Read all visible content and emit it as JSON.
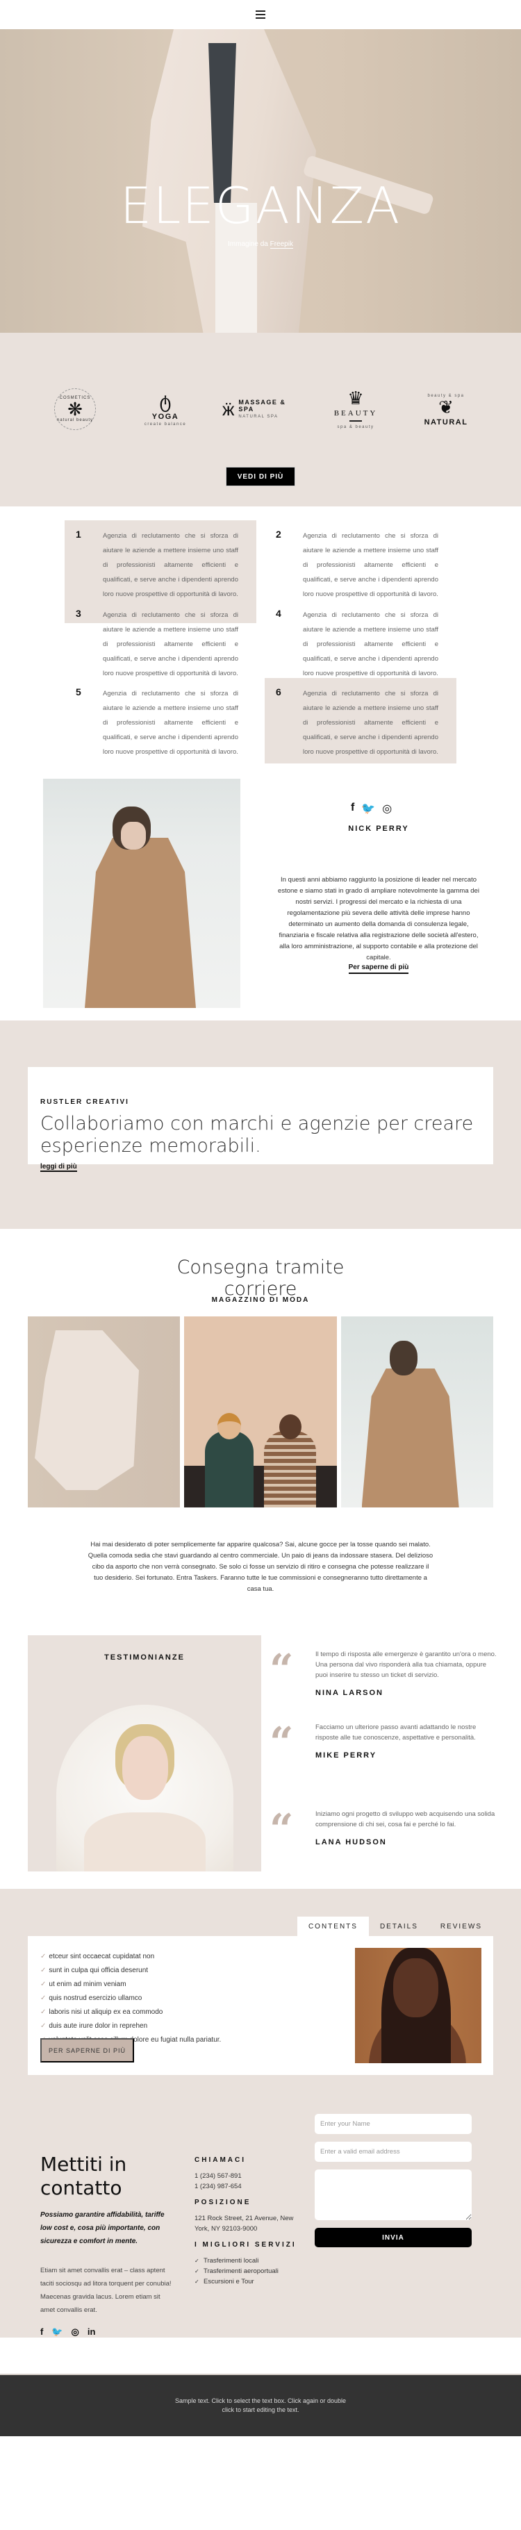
{
  "header": {
    "menu_icon": "hamburger-icon"
  },
  "hero": {
    "title": "ELEGANZA",
    "credit_prefix": "Immagine da ",
    "credit_link": "Freepik"
  },
  "logos": {
    "items": [
      {
        "name": "COSMETICS",
        "sub": "natural beauty",
        "icon": "flower-icon"
      },
      {
        "name": "YOGA",
        "sub": "create balance",
        "icon": "yoga-figure-icon"
      },
      {
        "name": "MASSAGE & SPA",
        "sub": "NATURAL SPA",
        "icon": "butterfly-figure-icon"
      },
      {
        "name": "BEAUTY",
        "sub": "spa & beauty",
        "icon": "lotus-icon"
      },
      {
        "name": "NATURAL",
        "sub": "beauty & spa",
        "icon": "leaves-figure-icon"
      }
    ],
    "cta": "VEDI DI PIÙ"
  },
  "numbered": {
    "items": [
      {
        "num": "1",
        "text": "Agenzia di reclutamento che si sforza di aiutare le aziende a mettere insieme uno staff di professionisti altamente efficienti e qualificati, e serve anche i dipendenti aprendo loro nuove prospettive di opportunità di lavoro.",
        "highlighted": true
      },
      {
        "num": "2",
        "text": "Agenzia di reclutamento che si sforza di aiutare le aziende a mettere insieme uno staff di professionisti altamente efficienti e qualificati, e serve anche i dipendenti aprendo loro nuove prospettive di opportunità di lavoro.",
        "highlighted": false
      },
      {
        "num": "3",
        "text": "Agenzia di reclutamento che si sforza di aiutare le aziende a mettere insieme uno staff di professionisti altamente efficienti e qualificati, e serve anche i dipendenti aprendo loro nuove prospettive di opportunità di lavoro.",
        "highlighted": false
      },
      {
        "num": "4",
        "text": "Agenzia di reclutamento che si sforza di aiutare le aziende a mettere insieme uno staff di professionisti altamente efficienti e qualificati, e serve anche i dipendenti aprendo loro nuove prospettive di opportunità di lavoro.",
        "highlighted": false
      },
      {
        "num": "5",
        "text": "Agenzia di reclutamento che si sforza di aiutare le aziende a mettere insieme uno staff di professionisti altamente efficienti e qualificati, e serve anche i dipendenti aprendo loro nuove prospettive di opportunità di lavoro.",
        "highlighted": false
      },
      {
        "num": "6",
        "text": "Agenzia di reclutamento che si sforza di aiutare le aziende a mettere insieme uno staff di professionisti altamente efficienti e qualificati, e serve anche i dipendenti aprendo loro nuove prospettive di opportunità di lavoro.",
        "highlighted": true
      }
    ]
  },
  "profile": {
    "social": [
      "f",
      "🐦",
      "◎"
    ],
    "name": "NICK PERRY",
    "bio": "In questi anni abbiamo raggiunto la posizione di leader nel mercato estone e siamo stati in grado di ampliare notevolmente la gamma dei nostri servizi. I progressi del mercato e la richiesta di una regolamentazione più severa delle attività delle imprese hanno determinato un aumento della domanda di consulenza legale, finanziaria e fiscale relativa alla registrazione delle società all'estero, alla loro amministrazione, al supporto contabile e alla protezione del capitale.",
    "link": "Per saperne di più"
  },
  "creative": {
    "kicker": "RUSTLER CREATIVI",
    "headline": "Collaboriamo con marchi e agenzie per creare esperienze memorabili.",
    "link": "leggi di più"
  },
  "delivery": {
    "title": "Consegna tramite corriere",
    "subtitle": "MAGAZZINO DI MODA",
    "paragraph": "Hai mai desiderato di poter semplicemente far apparire qualcosa? Sai, alcune gocce per la tosse quando sei malato. Quella comoda sedia che stavi guardando al centro commerciale. Un paio di jeans da indossare stasera. Del delizioso cibo da asporto che non verrà consegnato. Se solo ci fosse un servizio di ritiro e consegna che potesse realizzare il tuo desiderio. Sei fortunato. Entra Taskers. Faranno tutte le tue commissioni e consegneranno tutto direttamente a casa tua."
  },
  "testimonials": {
    "heading": "TESTIMONIANZE",
    "items": [
      {
        "text": "Il tempo di risposta alle emergenze è garantito un'ora o meno. Una persona dal vivo risponderà alla tua chiamata, oppure puoi inserire tu stesso un ticket di servizio.",
        "name": "NINA LARSON"
      },
      {
        "text": "Facciamo un ulteriore passo avanti adattando le nostre risposte alle tue conoscenze, aspettative e personalità.",
        "name": "MIKE PERRY"
      },
      {
        "text": "Iniziamo ogni progetto di sviluppo web acquisendo una solida comprensione di chi sei, cosa fai e perché lo fai.",
        "name": "LANA HUDSON"
      }
    ]
  },
  "tabs": {
    "labels": [
      "CONTENTS",
      "DETAILS",
      "REVIEWS"
    ],
    "active": "CONTENTS",
    "checklist": [
      "etceur sint occaecat cupidatat non",
      "sunt in culpa qui officia deserunt",
      "ut enim ad minim veniam",
      "quis nostrud esercizio ullamco",
      "laboris nisi ut aliquip ex ea commodo",
      "duis aute irure dolor in reprehen",
      "voluptate velit esse cillum dolore eu fugiat nulla pariatur."
    ],
    "button": "PER SAPERNE DI PIÙ"
  },
  "contact": {
    "title": "Mettiti in contatto",
    "lead": "Possiamo garantire affidabilità, tariffe low cost e, cosa più importante, con sicurezza e comfort in mente.",
    "body": "Etiam sit amet convallis erat – class aptent taciti sociosqu ad litora torquent per conubia! Maecenas gravida lacus. Lorem etiam sit amet convallis erat.",
    "call_heading": "CHIAMACI",
    "phones": [
      "1 (234) 567-891",
      "1 (234) 987-654"
    ],
    "location_heading": "POSIZIONE",
    "address": "121 Rock Street, 21 Avenue, New York, NY 92103-9000",
    "services_heading": "I MIGLIORI SERVIZI",
    "services": [
      "Trasferimenti locali",
      "Trasferimenti aeroportuali",
      "Escursioni e Tour"
    ],
    "social": [
      "f",
      "🐦",
      "◎",
      "in"
    ],
    "form": {
      "name_placeholder": "Enter your Name",
      "email_placeholder": "Enter a valid email address",
      "message_placeholder": "",
      "submit": "INVIA"
    }
  },
  "footer": {
    "text": "Sample text. Click to select the text box. Click again or double click to start editing the text."
  }
}
